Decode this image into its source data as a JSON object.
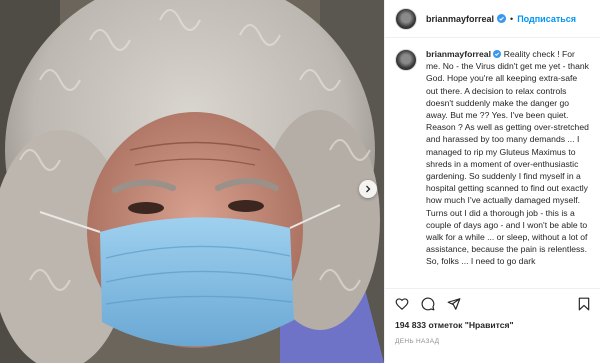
{
  "post": {
    "username": "brianmayforreal",
    "follow_label": "Подписаться",
    "separator": "•",
    "caption_username": "brianmayforreal",
    "caption_text": "Reality check ! For me. No - the Virus didn't get me yet - thank God. Hope you're all keeping extra-safe out there. A decision to relax controls doesn't suddenly make the danger go away. But me ?? Yes. I've been quiet. Reason ? As well as getting over-stretched and harassed by too many demands ... I managed to rip my Gluteus Maximus to shreds in a moment of over-enthusiastic gardening. So suddenly I find myself in a hospital getting scanned to find out exactly how much I've actually damaged myself. Turns out I did a thorough job - this is a couple of days ago - and I won't be able to walk for a while ... or sleep, without a lot of assistance, because the pain is relentless. So, folks ... I need to go dark",
    "likes_count": "194 833",
    "likes_text": "отметок \"Нравится\"",
    "time_ago": "ДЕНЬ НАЗАД"
  },
  "icons": {
    "verified": "verified-badge-icon",
    "like": "heart-icon",
    "comment": "comment-icon",
    "share": "share-icon",
    "save": "bookmark-icon",
    "next": "chevron-right-icon"
  },
  "colors": {
    "accent": "#0095f6",
    "text": "#262626",
    "muted": "#8e8e8e",
    "mask": "#8ec3e6"
  }
}
